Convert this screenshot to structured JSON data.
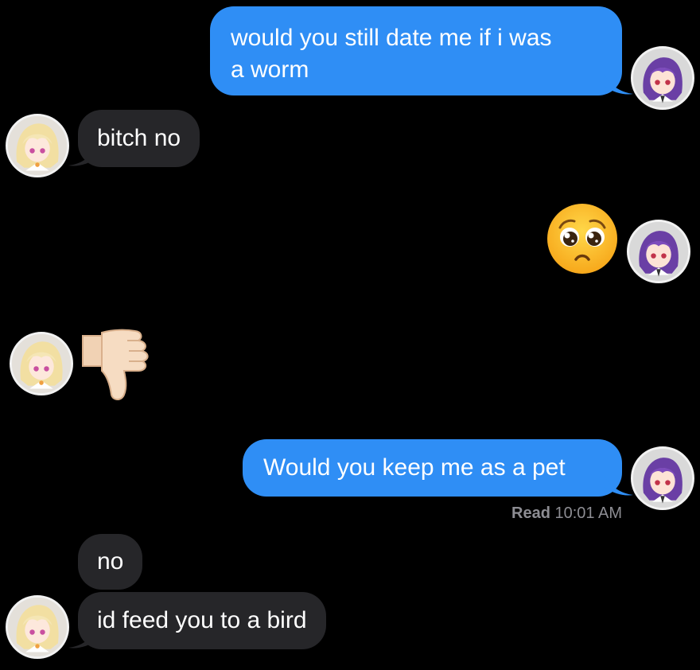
{
  "messages": [
    {
      "id": "m1",
      "direction": "sent",
      "text_line1": "would you still date me if i was",
      "text_line2": "a worm"
    },
    {
      "id": "m2",
      "direction": "received",
      "text": "bitch no"
    },
    {
      "id": "m3",
      "direction": "sent",
      "emoji": "pleading-face"
    },
    {
      "id": "m4",
      "direction": "received",
      "emoji": "thumbs-down"
    },
    {
      "id": "m5",
      "direction": "sent",
      "text": "Would you keep me as a pet"
    },
    {
      "id": "m6",
      "direction": "received",
      "text": "no"
    },
    {
      "id": "m7",
      "direction": "received",
      "text": "id feed you to a bird"
    }
  ],
  "receipt": {
    "label": "Read",
    "time": "10:01 AM"
  },
  "colors": {
    "sent_bubble": "#2f8ef5",
    "received_bubble": "#262629",
    "background": "#000000",
    "receipt_text": "#8d8d93"
  },
  "avatars": {
    "sender": "purple-hair-avatar",
    "receiver": "blonde-hair-avatar"
  }
}
